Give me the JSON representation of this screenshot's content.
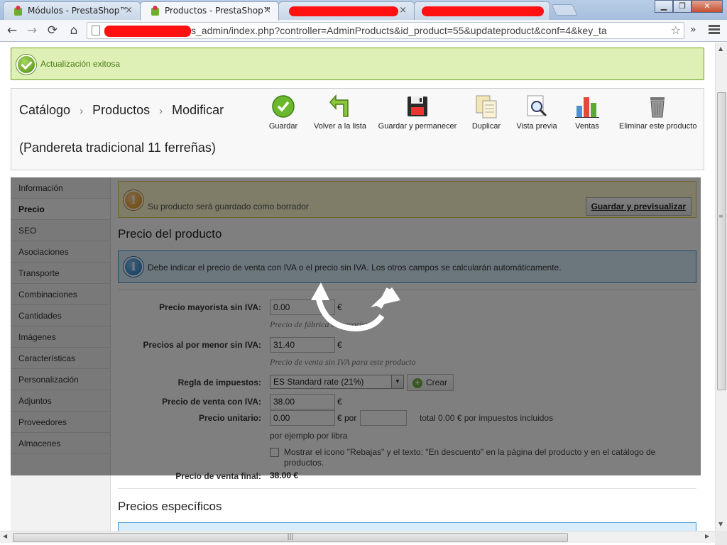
{
  "browser": {
    "tabs": [
      {
        "title": "Módulos - PrestaShop™",
        "active": false
      },
      {
        "title": "Productos - PrestaShop™",
        "active": true
      },
      {
        "title": "",
        "active": false,
        "redacted": true
      },
      {
        "title": "",
        "active": false,
        "redacted": true
      }
    ],
    "close_glyph": "×",
    "window_buttons": {
      "minimize": "▁",
      "maximize": "❐",
      "close": "✕"
    },
    "nav": {
      "back": "←",
      "forward": "→",
      "reload": "⟳",
      "home": "⌂",
      "overflow": "»"
    },
    "url": "s_admin/index.php?controller=AdminProducts&id_product=55&updateproduct&conf=4&key_ta",
    "star": "☆"
  },
  "success_message": "Actualización exitosa",
  "breadcrumb": {
    "items": [
      "Catálogo",
      "Productos",
      "Modificar"
    ],
    "separator": "›"
  },
  "product_title": "(Pandereta tradicional 11 ferreñas)",
  "actions": [
    {
      "label": "Guardar",
      "icon": "check-circle-icon"
    },
    {
      "label": "Volver a la lista",
      "icon": "back-arrow-icon"
    },
    {
      "label": "Guardar y permanecer",
      "icon": "floppy-disk-icon"
    },
    {
      "label": "Duplicar",
      "icon": "duplicate-pages-icon"
    },
    {
      "label": "Vista previa",
      "icon": "magnifier-page-icon"
    },
    {
      "label": "Ventas",
      "icon": "bar-chart-icon"
    },
    {
      "label": "Eliminar este producto",
      "icon": "trash-can-icon"
    }
  ],
  "sidebar": {
    "active": "Precio",
    "items": [
      "Información",
      "Precio",
      "SEO",
      "Asociaciones",
      "Transporte",
      "Combinaciones",
      "Cantidades",
      "Imágenes",
      "Características",
      "Personalización",
      "Adjuntos",
      "Proveedores",
      "Almacenes"
    ]
  },
  "draft_warning": {
    "text": "Su producto será guardado como borrador",
    "button": "Guardar y previsualizar",
    "icon_glyph": "!"
  },
  "price_section": {
    "title": "Precio del producto",
    "info_icon_glyph": "i",
    "info": "Debe indicar el precio de venta con IVA o el precio sin IVA. Los otros campos se calcularán automáticamente.",
    "wholesale": {
      "label": "Precio mayorista sin IVA:",
      "value": "0.00",
      "currency": "€",
      "hint": "Precio de fábrica o mayorista"
    },
    "retail": {
      "label": "Precios al por menor sin IVA:",
      "value": "31.40",
      "currency": "€",
      "hint": "Precio de venta sin IVA para este producto"
    },
    "tax_rule": {
      "label": "Regla de impuestos:",
      "value": "ES Standard rate (21%)",
      "arrow": "▼",
      "create_button": "Crear",
      "create_glyph": "+"
    },
    "retail_with_tax": {
      "label": "Precio de venta con IVA:",
      "value": "38.00",
      "currency": "€"
    },
    "unit_price": {
      "label": "Precio unitario:",
      "value": "0.00",
      "currency_per": "€ por",
      "unit_value": "",
      "total": "total 0.00 € por impuestos incluidos",
      "example": "por ejemplo por libra"
    },
    "on_sale": {
      "label": "Mostrar el icono \"Rebajas\" y el texto: \"En descuento\" en la página del producto y en el catálogo de productos.",
      "checked": false
    },
    "final": {
      "label": "Precio de venta final:",
      "value": "38.00 €"
    }
  },
  "specific_section": {
    "title": "Precios específicos"
  },
  "scrollbar": {
    "up": "▲",
    "down": "▼",
    "left": "◀",
    "right": "▶",
    "grip_h": "|||",
    "grip_v": "≡"
  },
  "colors": {
    "success_bg": "#dff0b7",
    "info_bg": "#d8ecfb",
    "warning_bg": "#fffbd0",
    "overlay": "rgba(0,0,0,0.5)",
    "redaction": "#ff1111"
  }
}
